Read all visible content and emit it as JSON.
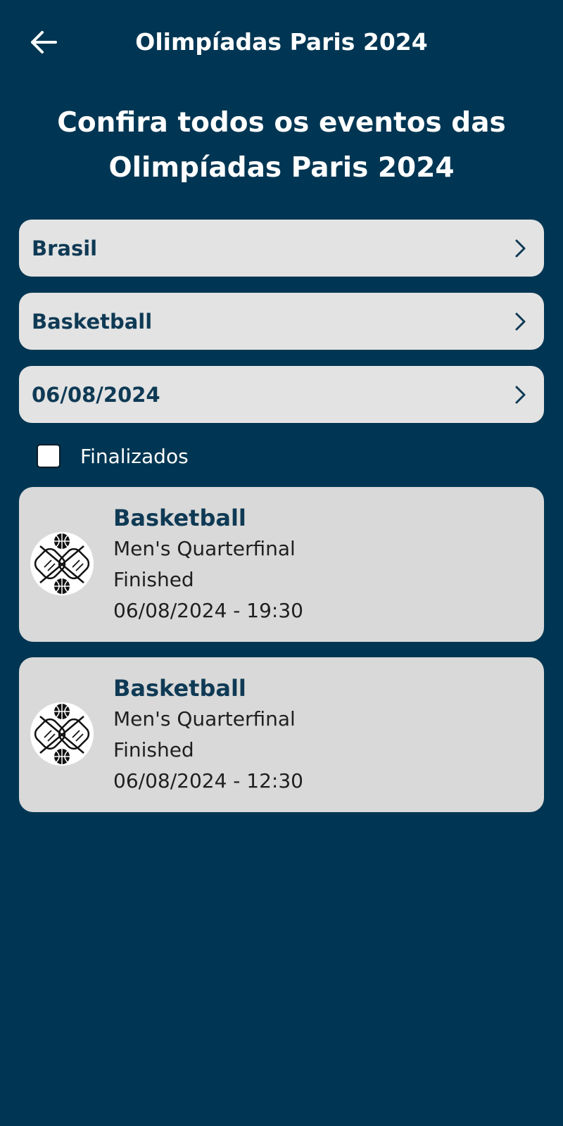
{
  "app_bar": {
    "title": "Olimpíadas Paris 2024",
    "back_icon": "arrow-left-icon"
  },
  "headline": {
    "line1": "Confira todos os eventos das",
    "line2": "Olimpíadas Paris 2024"
  },
  "filters": {
    "country": "Brasil",
    "sport": "Basketball",
    "date": "06/08/2024",
    "chevron_icon": "chevron-right-icon"
  },
  "finished_filter": {
    "label": "Finalizados",
    "checked": false
  },
  "events": [
    {
      "sport": "Basketball",
      "stage": "Men's Quarterfinal",
      "status": "Finished",
      "datetime": "06/08/2024 - 19:30",
      "icon": "basketball-pictogram-icon"
    },
    {
      "sport": "Basketball",
      "stage": "Men's Quarterfinal",
      "status": "Finished",
      "datetime": "06/08/2024 - 12:30",
      "icon": "basketball-pictogram-icon"
    }
  ],
  "colors": {
    "background": "#003653",
    "card": "#d9d9d9",
    "filter": "#e3e3e3",
    "accent_text": "#0f3a55"
  }
}
